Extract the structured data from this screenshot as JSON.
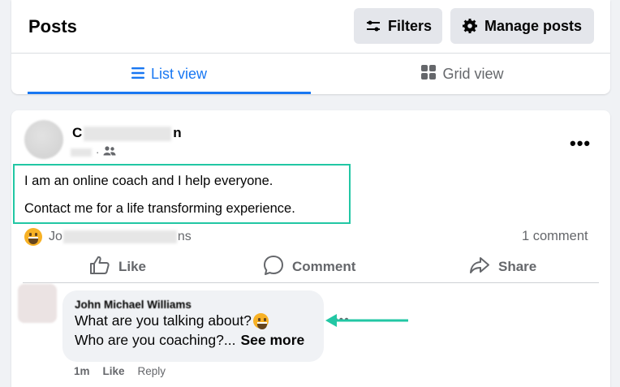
{
  "header": {
    "title": "Posts",
    "filters_label": "Filters",
    "manage_label": "Manage posts"
  },
  "tabs": [
    {
      "label": "List view",
      "active": true
    },
    {
      "label": "Grid view",
      "active": false
    }
  ],
  "post": {
    "author_visible_start": "C",
    "author_visible_end": "n",
    "text_lines": [
      "I am an online coach and I help everyone.",
      "Contact me for a life transforming experience."
    ],
    "reaction_name_start": "Jo",
    "reaction_name_end": "ns",
    "comment_count": "1 comment",
    "actions": {
      "like": "Like",
      "comment": "Comment",
      "share": "Share"
    }
  },
  "comment": {
    "author": "John Michael Williams",
    "line1": "What are you talking about?",
    "line2": "Who are you coaching?...",
    "see_more": "See more",
    "time": "1m",
    "like": "Like",
    "reply": "Reply"
  },
  "colors": {
    "accent": "#1877f2",
    "highlight": "#22c7a4",
    "secondary_text": "#65676b"
  }
}
